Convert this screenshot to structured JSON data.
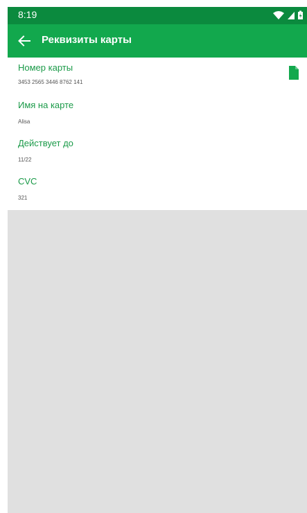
{
  "status_bar": {
    "time": "8:19",
    "icons": [
      "wifi-icon",
      "signal-icon",
      "battery-icon"
    ]
  },
  "app_bar": {
    "title": "Реквизиты карты",
    "back_icon": "arrow-left-icon"
  },
  "fields": [
    {
      "label": "Номер карты",
      "value": "3453 2565 3446 8762 141"
    },
    {
      "label": "Имя на карте",
      "value": "Alisa"
    },
    {
      "label": "Действует до",
      "value": "11/22"
    },
    {
      "label": "CVC",
      "value": "321"
    }
  ],
  "copy_icon": "copy-icon",
  "colors": {
    "status_bar": "#0b8a3e",
    "app_bar": "#12a84d",
    "label": "#1a9a48",
    "empty_area": "#e0e0e0"
  }
}
